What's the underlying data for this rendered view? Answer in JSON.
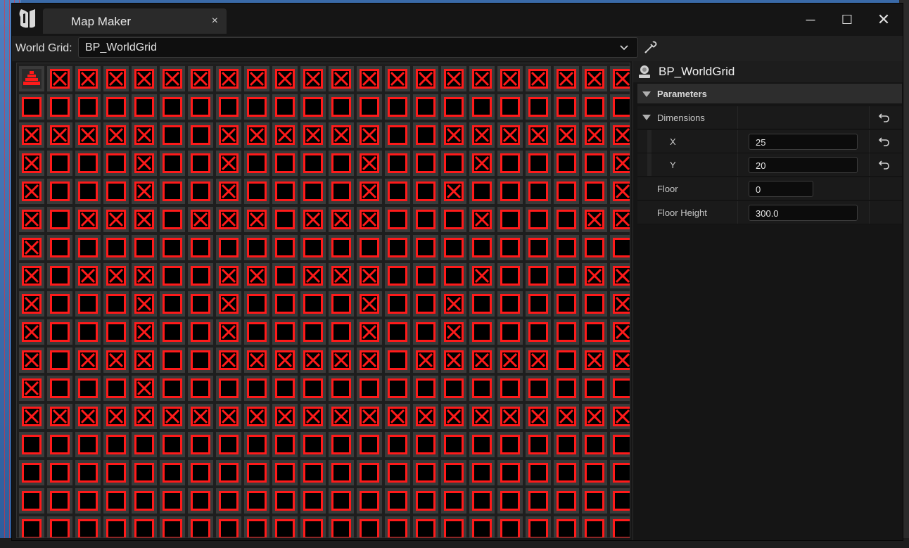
{
  "window": {
    "tab_title": "Map Maker",
    "tab_close": "×",
    "minimize": "─",
    "maximize": "☐",
    "close": "✕"
  },
  "toolbar": {
    "world_grid_label": "World Grid:",
    "world_grid_value": "BP_WorldGrid"
  },
  "details": {
    "title": "BP_WorldGrid",
    "category": "Parameters",
    "dimensions_label": "Dimensions",
    "x_label": "X",
    "x_value": "25",
    "y_label": "Y",
    "y_value": "20",
    "floor_label": "Floor",
    "floor_value": "0",
    "floor_height_label": "Floor Height",
    "floor_height_value": "300.0"
  },
  "grid": {
    "visible_columns": 22,
    "visible_rows": 17,
    "icons": {
      "blocked": "x-mark-icon",
      "open": "open-tile-icon",
      "stairs": "stairs-icon"
    },
    "colors": {
      "accent": "#ff1a1a",
      "tile": "#3a3a3a",
      "tile_inner": "#000000"
    },
    "rows": [
      "SXXXXXXXXXXXXXXXXXXXXX",
      "OOOOOOOOOOOOOOOOOOOOOO",
      "XXXXXOOXXXXXXOOXXXXXXX",
      "XOOOXOOXOOOOXOOOXOOOOX",
      "XOOOXOOXOOOOXOOXOOOOOX",
      "XOXXXOXXXOXXXOOOXOOOXX",
      "XOOOOOOOOOOOOOOOOOOOOO",
      "XOXXXOOXXOXXXOOOXOOOXX",
      "XOOOXOOXOOOOXOOXOOOOOX",
      "XOOOXOOXOOOOXOOXOOOOOX",
      "XOXXXOOXXXXXXOXXXXXOXX",
      "XOOOXOOOOOOOOOOOOOOOOO",
      "XXXXXXXXXXXXXXXXXXXXXX",
      "OOOOOOOOOOOOOOOOOOOOOO",
      "OOOOOOOOOOOOOOOOOOOOOO",
      "OOOOOOOOOOOOOOOOOOOOOO",
      "OOOOOOOOOOOOOOOOOOOOOO"
    ]
  }
}
